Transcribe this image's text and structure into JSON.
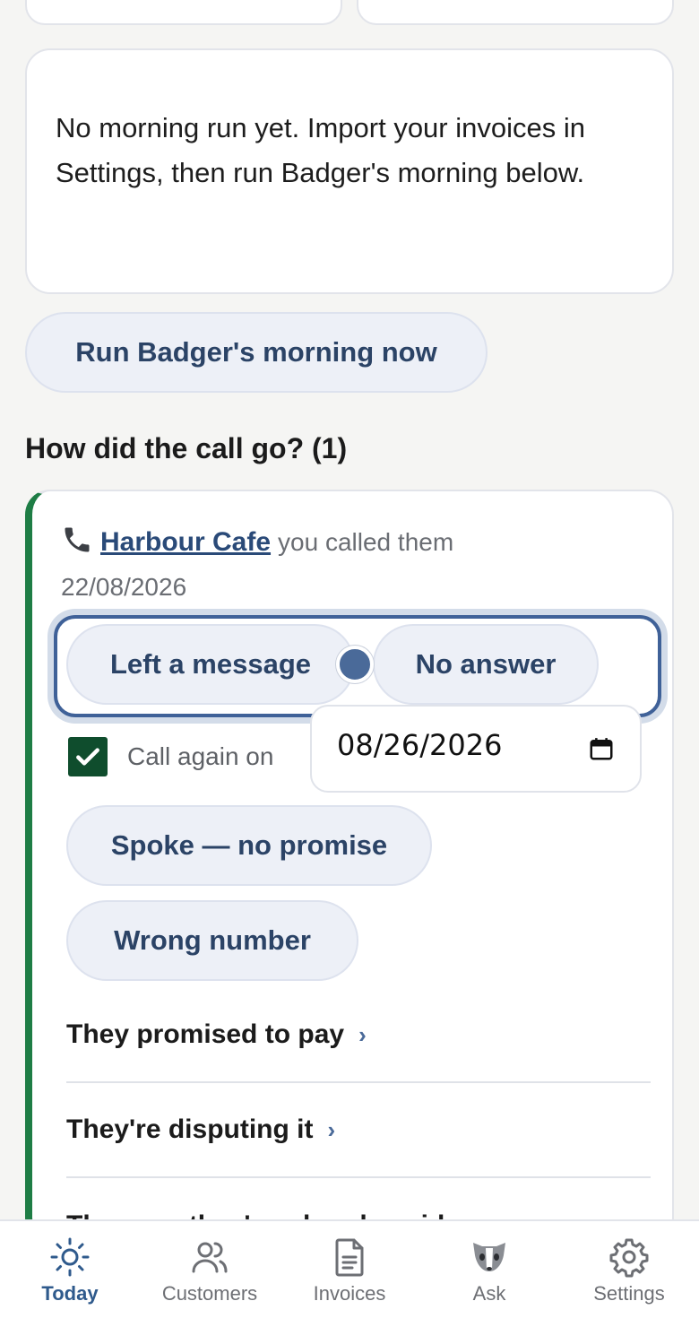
{
  "info": {
    "message": "No morning run yet. Import your invoices in Settings, then run Badger's morning below."
  },
  "run_button": "Run Badger's morning now",
  "section_title": "How did the call go? (1)",
  "call": {
    "customer": "Harbour Cafe",
    "note": "you called them",
    "date": "22/08/2026",
    "options": {
      "left_message": "Left a message",
      "no_answer": "No answer",
      "spoke": "Spoke — no promise",
      "wrong_number": "Wrong number"
    },
    "call_again_label": "Call again on",
    "call_again_checked": true,
    "call_again_date": "08/26/2026",
    "rows": {
      "promised": "They promised to pay",
      "disputing": "They're disputing it",
      "already_paid": "They say they've already paid"
    },
    "accent_color": "#1e7d45"
  },
  "nav": {
    "today": "Today",
    "customers": "Customers",
    "invoices": "Invoices",
    "ask": "Ask",
    "settings": "Settings"
  }
}
